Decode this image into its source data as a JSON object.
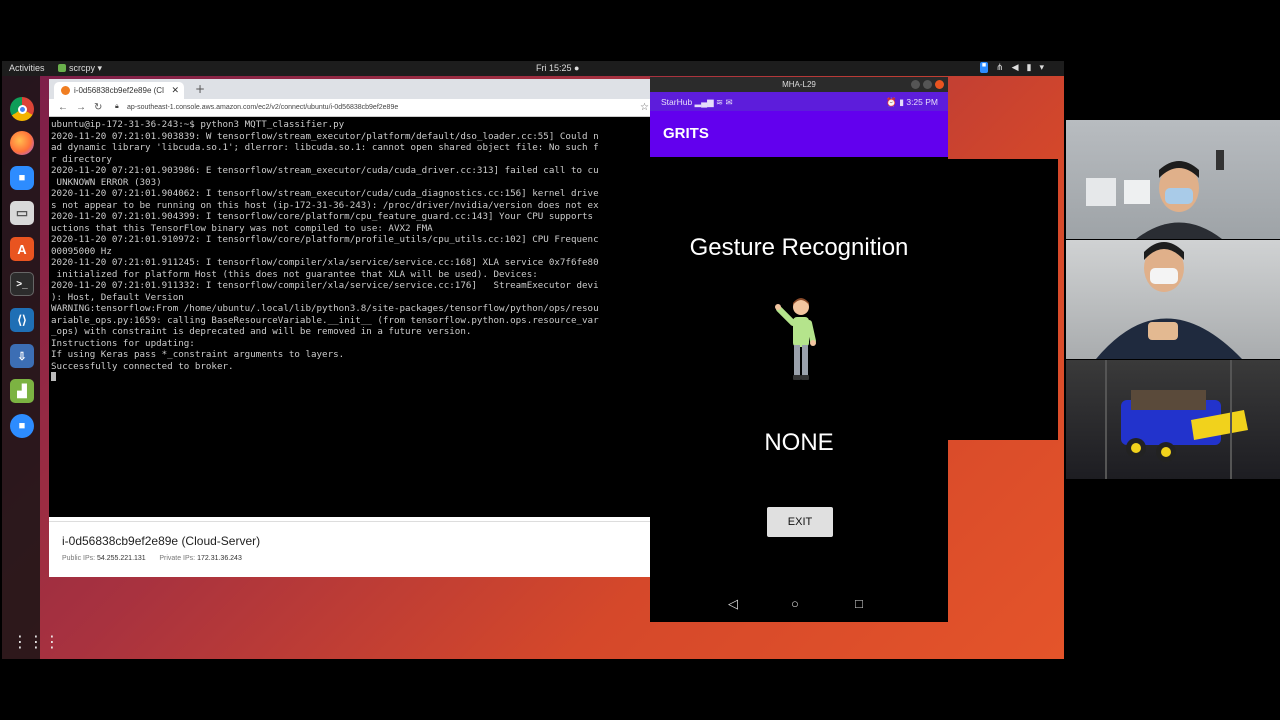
{
  "topbar": {
    "activities": "Activities",
    "app_name": "scrcpy ▾",
    "clock": "Fri 15:25 ●"
  },
  "dock": {
    "icons": [
      "chrome-icon",
      "firefox-icon",
      "zoom-icon",
      "files-icon",
      "software-icon",
      "terminal-icon",
      "vscode-icon",
      "installer-icon",
      "android-icon",
      "zoom-icon"
    ]
  },
  "browser": {
    "tab_title": "i-0d56838cb9ef2e89e (Cl",
    "url": "ap-southeast-1.console.aws.amazon.com/ec2/v2/connect/ubuntu/i-0d56838cb9ef2e89e",
    "terminal_lines": [
      "ubuntu@ip-172-31-36-243:~$ python3 MQTT_classifier.py",
      "2020-11-20 07:21:01.903839: W tensorflow/stream_executor/platform/default/dso_loader.cc:55] Could n",
      "ad dynamic library 'libcuda.so.1'; dlerror: libcuda.so.1: cannot open shared object file: No such f",
      "r directory",
      "2020-11-20 07:21:01.903986: E tensorflow/stream_executor/cuda/cuda_driver.cc:313] failed call to cu",
      " UNKNOWN ERROR (303)",
      "2020-11-20 07:21:01.904062: I tensorflow/stream_executor/cuda/cuda_diagnostics.cc:156] kernel drive",
      "s not appear to be running on this host (ip-172-31-36-243): /proc/driver/nvidia/version does not ex",
      "2020-11-20 07:21:01.904399: I tensorflow/core/platform/cpu_feature_guard.cc:143] Your CPU supports",
      "uctions that this TensorFlow binary was not compiled to use: AVX2 FMA",
      "2020-11-20 07:21:01.910972: I tensorflow/core/platform/profile_utils/cpu_utils.cc:102] CPU Frequenc",
      "00095000 Hz",
      "2020-11-20 07:21:01.911245: I tensorflow/compiler/xla/service/service.cc:168] XLA service 0x7f6fe80",
      " initialized for platform Host (this does not guarantee that XLA will be used). Devices:",
      "2020-11-20 07:21:01.911332: I tensorflow/compiler/xla/service/service.cc:176]   StreamExecutor devi",
      "): Host, Default Version",
      "WARNING:tensorflow:From /home/ubuntu/.local/lib/python3.8/site-packages/tensorflow/python/ops/resou",
      "ariable_ops.py:1659: calling BaseResourceVariable.__init__ (from tensorflow.python.ops.resource_var",
      "_ops) with constraint is deprecated and will be removed in a future version.",
      "Instructions for updating:",
      "If using Keras pass *_constraint arguments to layers.",
      "Successfully connected to broker."
    ],
    "instance": {
      "title": "i-0d56838cb9ef2e89e (Cloud-Server)",
      "public_label": "Public IPs:",
      "public_ip": "54.255.221.131",
      "private_label": "Private IPs:",
      "private_ip": "172.31.36.243"
    }
  },
  "phone": {
    "window_title": "MHA-L29",
    "carrier": "StarHub",
    "time": "3:25 PM",
    "app_title": "GRITS",
    "heading": "Gesture Recognition",
    "gesture": "NONE",
    "exit_label": "EXIT",
    "nav_back": "◁",
    "nav_home": "○",
    "nav_recent": "□",
    "accent": "#6200ee",
    "status_color": "#5d1ddb"
  }
}
